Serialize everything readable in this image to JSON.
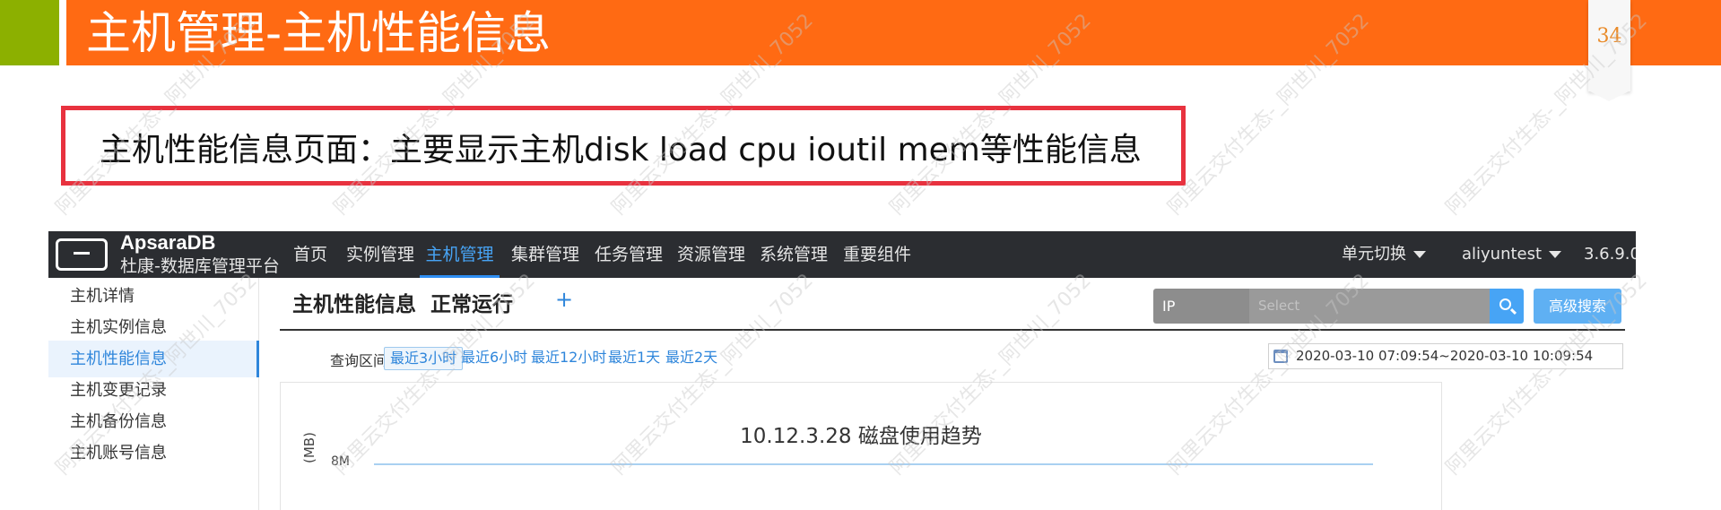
{
  "slide": {
    "title": "主机管理-主机性能信息",
    "page_number": "34",
    "callout": "主机性能信息页面：主要显示主机disk  load  cpu ioutil mem等性能信息",
    "watermark": "阿里云交付生态-_阿世川_7052"
  },
  "app": {
    "brand": {
      "name": "ApsaraDB",
      "subtitle": "杜康-数据库管理平台"
    },
    "nav": [
      "首页",
      "实例管理",
      "主机管理",
      "集群管理",
      "任务管理",
      "资源管理",
      "系统管理",
      "重要组件"
    ],
    "nav_active": "主机管理",
    "nav_right": {
      "switch_unit": "单元切换",
      "user": "aliyuntest",
      "version": "3.6.9.0"
    },
    "sidebar": [
      "主机详情",
      "主机实例信息",
      "主机性能信息",
      "主机变更记录",
      "主机备份信息",
      "主机账号信息"
    ],
    "sidebar_active": "主机性能信息",
    "page_title": "主机性能信息",
    "status": "正常运行",
    "add_icon": "+",
    "search": {
      "field": "IP",
      "placeholder": "Select",
      "advanced": "高级搜索"
    },
    "query_range": {
      "label": "查询区间:",
      "options": [
        "最近3小时",
        "最近6小时",
        "最近12小时",
        "最近1天",
        "最近2天"
      ],
      "selected": "最近3小时",
      "date_range": "2020-03-10 07:09:54~2020-03-10 10:09:54"
    },
    "chart": {
      "title": "10.12.3.28 磁盘使用趋势",
      "y_axis_label": "(MB)",
      "y_ticks": [
        "8M"
      ]
    }
  },
  "colors": {
    "slide_orange": "#ff6a13",
    "slide_green": "#8cb000",
    "callout_border": "#e8323f",
    "nav_bg": "#2b2d31",
    "accent_blue": "#2f86db"
  }
}
